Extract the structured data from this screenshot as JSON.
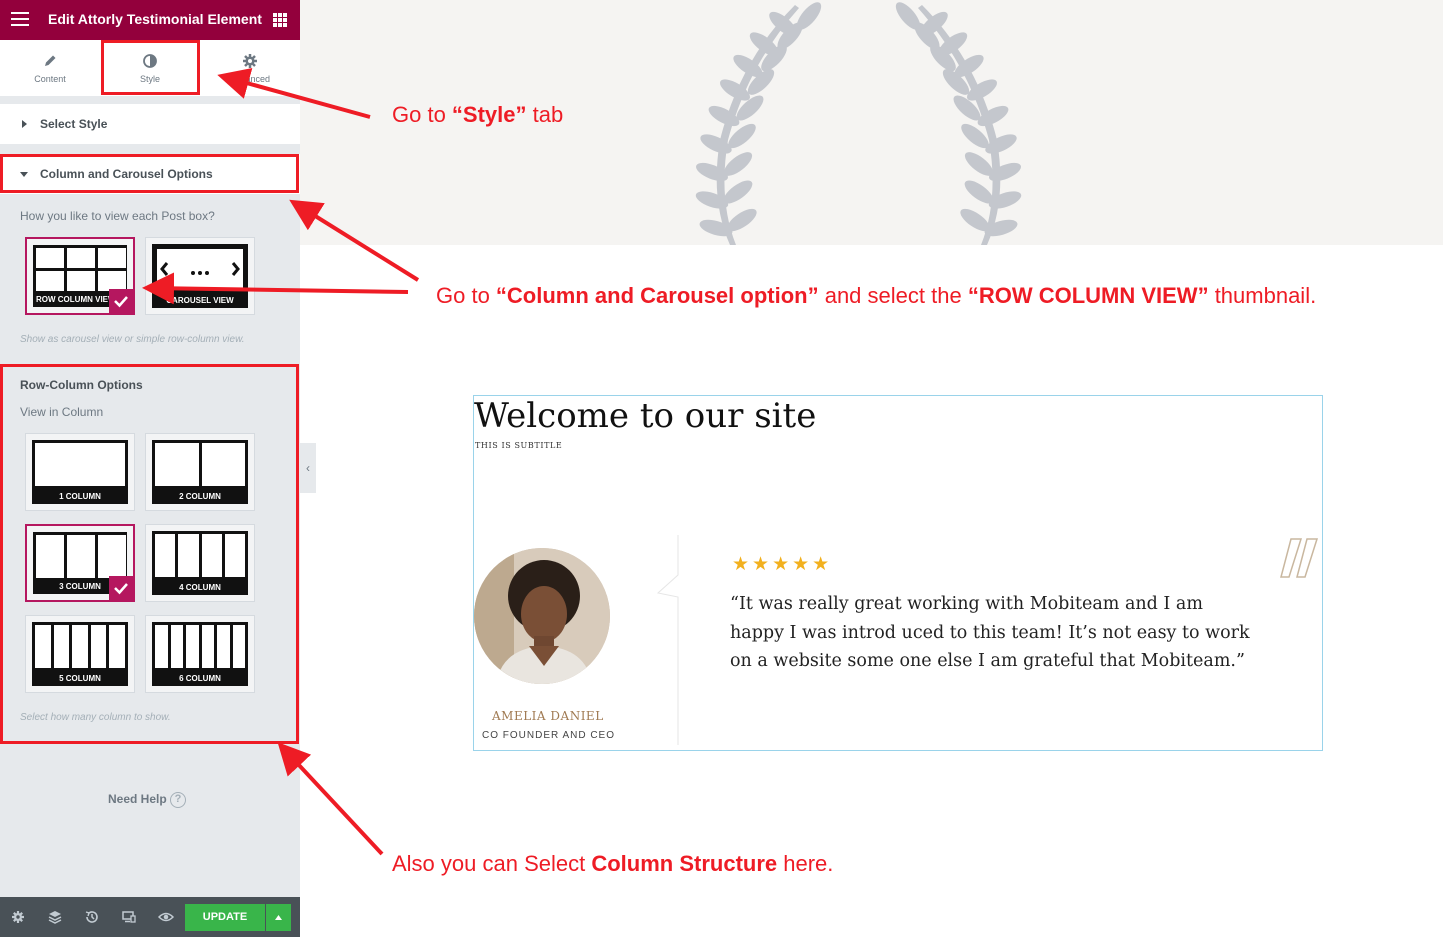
{
  "editor": {
    "title": "Edit Attorly Testimonial Element",
    "tabs": [
      {
        "label": "Content",
        "icon": "pencil-icon"
      },
      {
        "label": "Style",
        "icon": "contrast-icon"
      },
      {
        "label": "Advanced",
        "icon": "gear-icon"
      }
    ],
    "sections": {
      "select_style": "Select Style",
      "column_carousel": "Column and Carousel Options"
    },
    "view_question": "How you like to view each Post box?",
    "view_options": [
      {
        "label": "ROW COLUMN VIEW",
        "selected": true
      },
      {
        "label": "CAROUSEL VIEW",
        "selected": false
      }
    ],
    "view_note": "Show as carousel view or simple row-column view.",
    "row_column": {
      "title": "Row-Column Options",
      "subtitle": "View in Column",
      "options": [
        {
          "label": "1 COLUMN",
          "columns": 1,
          "selected": false
        },
        {
          "label": "2 COLUMN",
          "columns": 2,
          "selected": false
        },
        {
          "label": "3 COLUMN",
          "columns": 3,
          "selected": true
        },
        {
          "label": "4 COLUMN",
          "columns": 4,
          "selected": false
        },
        {
          "label": "5 COLUMN",
          "columns": 5,
          "selected": false
        },
        {
          "label": "6 COLUMN",
          "columns": 6,
          "selected": false
        }
      ],
      "note": "Select how many column to show."
    },
    "need_help": "Need Help",
    "update_label": "UPDATE",
    "footer_icons": [
      "settings-icon",
      "layers-icon",
      "history-icon",
      "responsive-icon",
      "preview-eye-icon"
    ]
  },
  "preview": {
    "heading": "Welcome to our site",
    "subtitle": "THIS IS SUBTITLE",
    "testimonial": {
      "rating": 5,
      "stars": "★★★★★",
      "quote": "“It was really great working with Mobiteam and I am happy I was introd uced to this team! It’s not easy to work on a website some one else I am grateful that Mobiteam.”",
      "name": "AMELIA DANIEL",
      "role": "CO FOUNDER AND CEO"
    }
  },
  "annotations": {
    "style_tab": {
      "pre": "Go  to ",
      "bold": "“Style”",
      "post": " tab"
    },
    "column_option": {
      "pre": "Go to ",
      "bold1": "“Column and Carousel option”",
      "mid": " and select the ",
      "bold2": "“ROW COLUMN VIEW”",
      "post": " thumbnail."
    },
    "structure": {
      "pre": "Also you can Select ",
      "bold": "Column Structure",
      "post": " here."
    }
  },
  "colors": {
    "topbar": "#93003c",
    "accent_selected": "#b5175f",
    "update": "#39b54a",
    "annotation": "#ee1c25",
    "star": "#f2b01e",
    "name": "#a07a52"
  }
}
